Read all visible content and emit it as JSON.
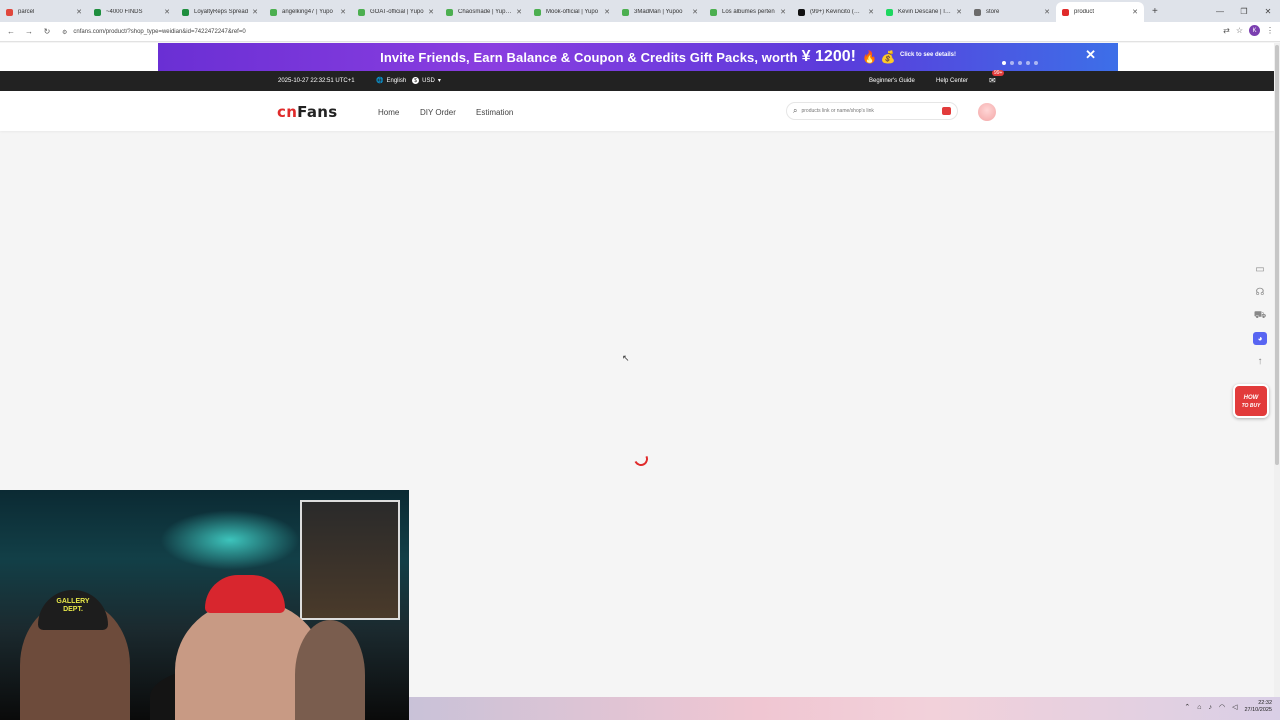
{
  "browser": {
    "tabs": [
      {
        "title": "parcel",
        "color": "#e0473c"
      },
      {
        "title": "~4000 FINDS",
        "color": "#1e8e3e"
      },
      {
        "title": "LoyaltyReps Spread",
        "color": "#1e8e3e"
      },
      {
        "title": "angelking47 | Yupo",
        "color": "#4caf50"
      },
      {
        "title": "GOAT-official | Yupo",
        "color": "#4caf50"
      },
      {
        "title": "Chaosmade | Yupoo",
        "color": "#4caf50"
      },
      {
        "title": "Mook-official | Yupo",
        "color": "#4caf50"
      },
      {
        "title": "3MadMan | Yupoo",
        "color": "#4caf50"
      },
      {
        "title": "Los álbumes perten",
        "color": "#4caf50"
      },
      {
        "title": "(99+) Kevincito (@ka",
        "color": "#111111"
      },
      {
        "title": "Kevin Descane | Inst",
        "color": "#1ed760"
      },
      {
        "title": "store",
        "color": "#6b6b6b"
      },
      {
        "title": "product",
        "color": "#e02b2b",
        "active": true
      }
    ],
    "url": "cnfans.com/product/?shop_type=weidian&id=7422472247&ref=0"
  },
  "banner": {
    "text": "Invite Friends, Earn Balance & Coupon & Credits Gift Packs, worth",
    "amount": "¥ 1200!",
    "cta": "Click to see details!"
  },
  "topbar": {
    "datetime": "2025-10-27 22:32:51 UTC+1",
    "language": "English",
    "currency": "USD",
    "currency_symbol": "$",
    "beginners_guide": "Beginner's Guide",
    "help_center": "Help Center",
    "message_badge": "99+"
  },
  "header": {
    "logo_accent": "cn",
    "logo_main": "Fans",
    "nav": [
      "Home",
      "DIY Order",
      "Estimation"
    ],
    "search_placeholder": "products link or name/shop's link"
  },
  "sidebar": {
    "howto_line1": "HOW",
    "howto_line2": "TO BUY"
  },
  "taskbar": {
    "time": "22:32",
    "date": "27/10/2025"
  },
  "webcam": {
    "hat_text_1": "GALLERY",
    "hat_text_2": "DEPT."
  },
  "colors": {
    "brand_red": "#e02b2b",
    "topbar_bg": "#222222",
    "discord": "#5865f2"
  }
}
